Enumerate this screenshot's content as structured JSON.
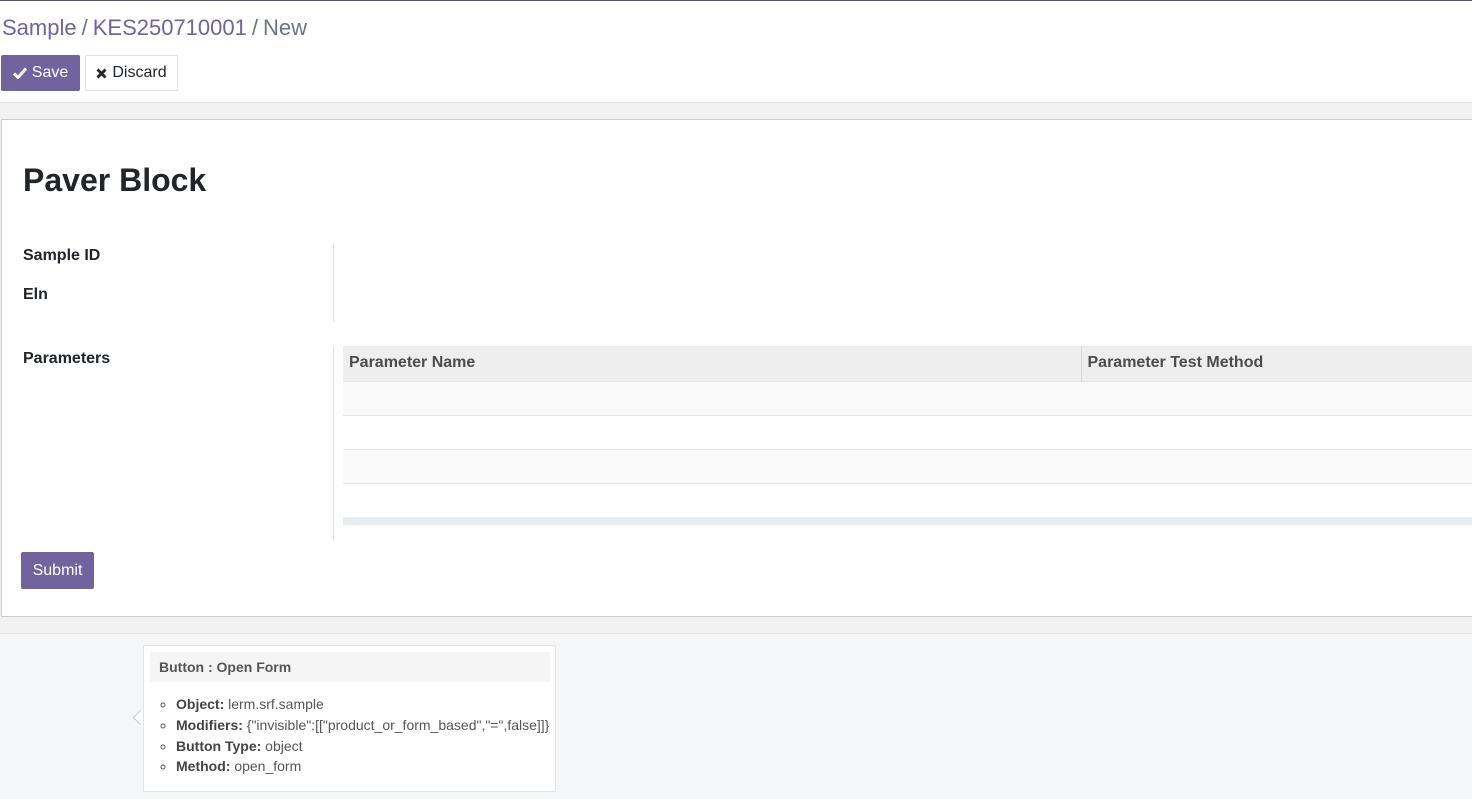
{
  "breadcrumb": {
    "items": [
      "Sample",
      "KES250710001"
    ],
    "separator": "/",
    "active": "New"
  },
  "toolbar": {
    "save_label": "Save",
    "discard_label": "Discard"
  },
  "icons": {
    "save": "check-icon",
    "discard": "x-icon"
  },
  "form": {
    "title": "Paver Block",
    "fields": {
      "sample_id_label": "Sample ID",
      "eln_label": "Eln",
      "parameters_label": "Parameters"
    },
    "parameters_table": {
      "columns": [
        "Parameter Name",
        "Parameter Test Method"
      ],
      "rows": [
        [
          "",
          ""
        ],
        [
          "",
          ""
        ],
        [
          "",
          ""
        ],
        [
          "",
          ""
        ]
      ]
    },
    "submit_label": "Submit"
  },
  "tooltip": {
    "header": "Button : Open Form",
    "items": [
      {
        "label": "Object:",
        "value": " lerm.srf.sample"
      },
      {
        "label": "Modifiers:",
        "value": " {\"invisible\":[[\"product_or_form_based\",\"=\",false]]}"
      },
      {
        "label": "Button Type:",
        "value": " object"
      },
      {
        "label": "Method:",
        "value": " open_form"
      }
    ]
  },
  "colors": {
    "primary": "#71639e",
    "background": "#f5f6f7"
  }
}
